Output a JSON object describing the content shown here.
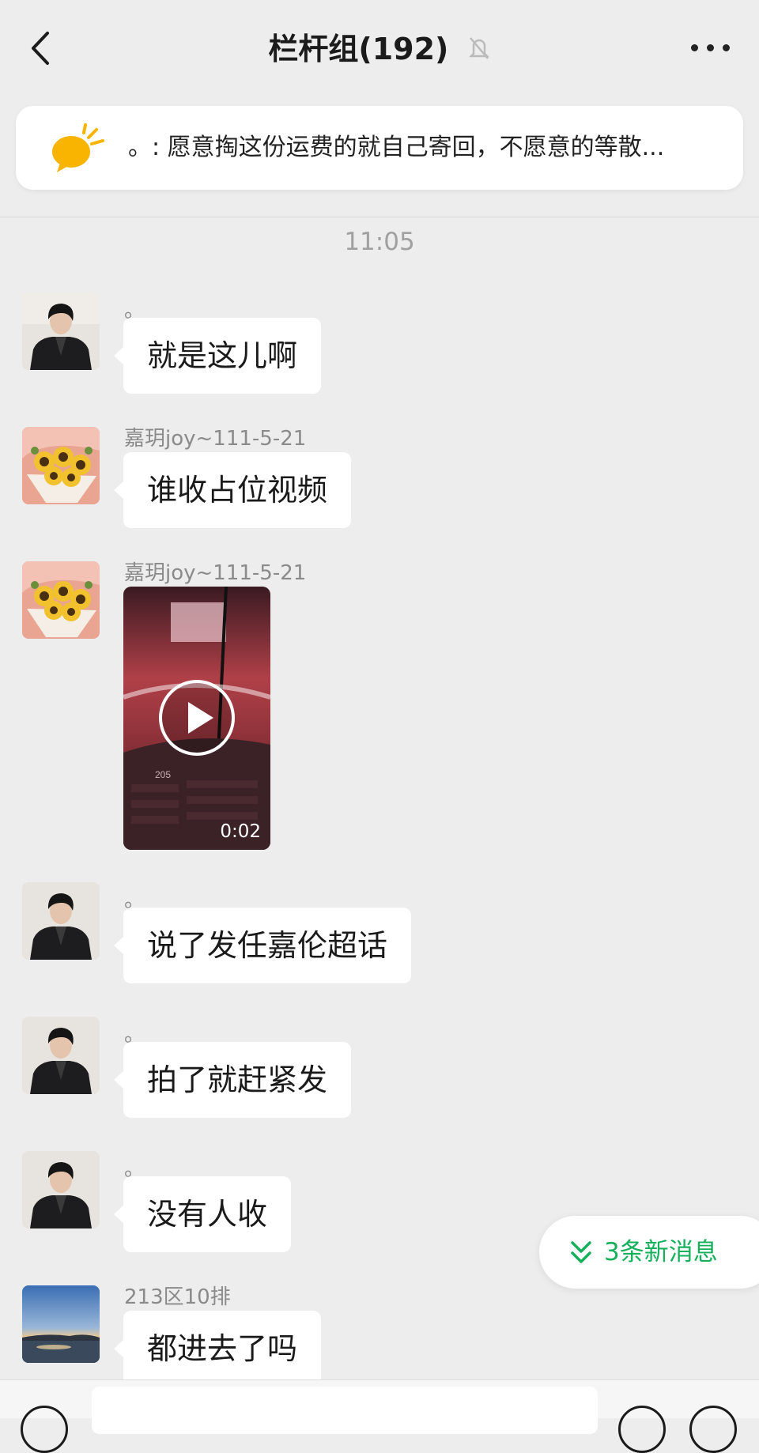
{
  "header": {
    "title": "栏杆组(192)",
    "back_icon": "chevron-left-icon",
    "mute_icon": "bell-slash-icon",
    "more_icon": "more-horizontal-icon"
  },
  "announcement": {
    "icon": "announcement-megaphone-icon",
    "text": "。: 愿意掏这份运费的就自己寄回，不愿意的等散..."
  },
  "timestamp": "11:05",
  "messages": [
    {
      "sender": "。",
      "text": "就是这儿啊",
      "avatar": "avatar-man-black-jacket"
    },
    {
      "sender": "嘉玥joy~111-5-21",
      "text": "谁收占位视频",
      "avatar": "avatar-sunflower-bouquet"
    },
    {
      "sender": "嘉玥joy~111-5-21",
      "video_duration": "0:02",
      "video_seat_label": "205",
      "avatar": "avatar-sunflower-bouquet"
    },
    {
      "sender": "。",
      "text": "说了发任嘉伦超话",
      "avatar": "avatar-man-black-jacket"
    },
    {
      "sender": "。",
      "text": "拍了就赶紧发",
      "avatar": "avatar-man-black-jacket"
    },
    {
      "sender": "。",
      "text": "没有人收",
      "avatar": "avatar-man-black-jacket"
    },
    {
      "sender": "213区10排",
      "text": "都进去了吗",
      "avatar": "avatar-sunset-lake"
    }
  ],
  "new_messages_button": {
    "label": "3条新消息",
    "icon": "double-chevron-down-icon"
  },
  "colors": {
    "background": "#ededed",
    "bubble": "#ffffff",
    "accent_green": "#16b05c",
    "sender_gray": "#8a8a8a"
  }
}
